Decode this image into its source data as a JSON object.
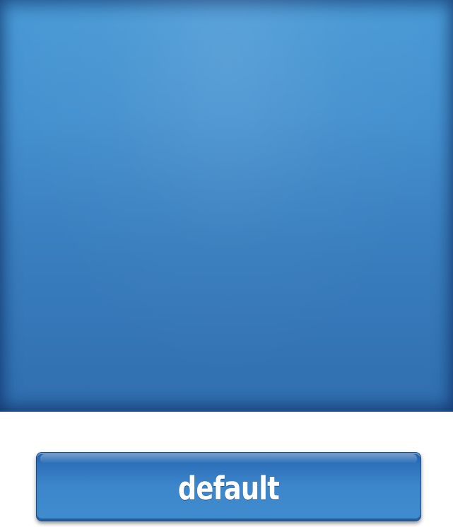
{
  "screen": {
    "button_label": "default",
    "colors": {
      "panel_top": "#4a9ad6",
      "panel_bottom": "#306eaf",
      "button_top": "#1f61ad",
      "button_bottom": "#3e8ccd",
      "button_text": "#ffffff",
      "background": "#ffffff"
    }
  }
}
